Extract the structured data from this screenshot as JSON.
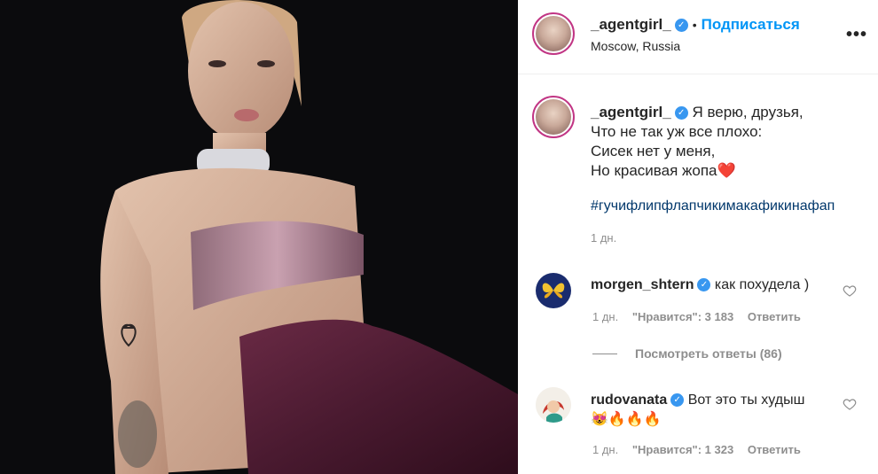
{
  "post": {
    "author": "_agentgirl_",
    "follow_label": "Подписаться",
    "location": "Moscow, Russia",
    "more_label": "•••"
  },
  "caption": {
    "author": "_agentgirl_",
    "lines": [
      "Я верю, друзья,",
      "Что не так уж все плохо:",
      "Сисек нет у меня,",
      "Но красивая жопа"
    ],
    "emoji": "❤️",
    "hashtag": "#гучифлипфлапчикимакафикинафап",
    "time": "1 дн."
  },
  "comments": [
    {
      "user": "morgen_shtern",
      "text": "как похудела )",
      "time": "1 дн.",
      "likes": "\"Нравится\": 3 183",
      "reply": "Ответить",
      "view_replies": "Посмотреть ответы (86)"
    },
    {
      "user": "rudovanata",
      "text": "Вот это ты худыш",
      "emoji_line": "😻🔥🔥🔥",
      "time": "1 дн.",
      "likes": "\"Нравится\": 1 323",
      "reply": "Ответить"
    }
  ],
  "colors": {
    "verified": "#3897f0",
    "follow": "#0095f6",
    "hashtag": "#00376b",
    "muted": "#8e8e8e",
    "avatar_ring": "#c13584"
  }
}
